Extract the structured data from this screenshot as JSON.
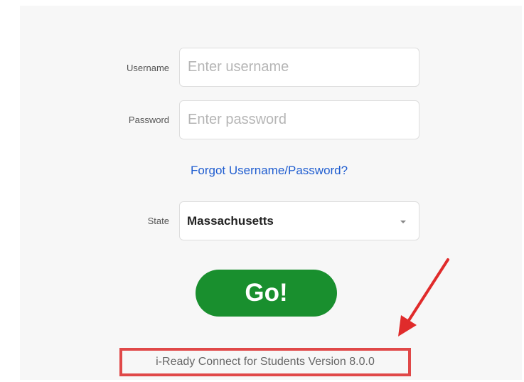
{
  "form": {
    "username_label": "Username",
    "username_placeholder": "Enter username",
    "password_label": "Password",
    "password_placeholder": "Enter password",
    "forgot_link": "Forgot Username/Password?",
    "state_label": "State",
    "state_value": "Massachusetts",
    "go_button": "Go!"
  },
  "footer": {
    "version_text": "i-Ready Connect for Students Version 8.0.0"
  },
  "annotation": {
    "highlight_color": "#e04848",
    "arrow_icon": "red-arrow-icon"
  },
  "colors": {
    "go_button": "#198f2e",
    "link": "#1f5dd0"
  }
}
